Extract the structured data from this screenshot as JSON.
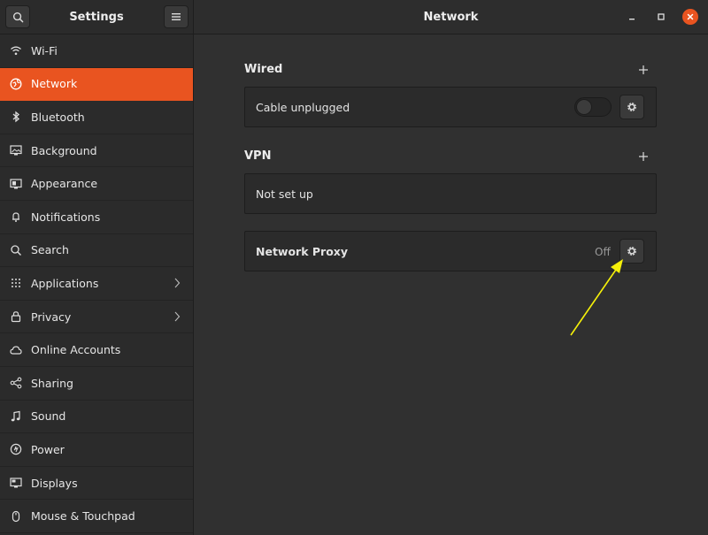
{
  "header": {
    "sidebar_title": "Settings",
    "page_title": "Network"
  },
  "sidebar": {
    "items": [
      {
        "label": "Wi-Fi",
        "icon": "wifi-icon",
        "active": false
      },
      {
        "label": "Network",
        "icon": "network-icon",
        "active": true
      },
      {
        "label": "Bluetooth",
        "icon": "bluetooth-icon",
        "active": false
      },
      {
        "label": "Background",
        "icon": "background-icon",
        "active": false
      },
      {
        "label": "Appearance",
        "icon": "appearance-icon",
        "active": false
      },
      {
        "label": "Notifications",
        "icon": "bell-icon",
        "active": false
      },
      {
        "label": "Search",
        "icon": "search-icon",
        "active": false
      },
      {
        "label": "Applications",
        "icon": "apps-grid-icon",
        "active": false,
        "chevron": true
      },
      {
        "label": "Privacy",
        "icon": "lock-icon",
        "active": false,
        "chevron": true
      },
      {
        "label": "Online Accounts",
        "icon": "cloud-icon",
        "active": false
      },
      {
        "label": "Sharing",
        "icon": "share-icon",
        "active": false
      },
      {
        "label": "Sound",
        "icon": "music-note-icon",
        "active": false
      },
      {
        "label": "Power",
        "icon": "power-icon",
        "active": false
      },
      {
        "label": "Displays",
        "icon": "display-icon",
        "active": false
      },
      {
        "label": "Mouse & Touchpad",
        "icon": "mouse-icon",
        "active": false
      }
    ]
  },
  "wired": {
    "title": "Wired",
    "connection_label": "Cable unplugged",
    "toggle_on": false
  },
  "vpn": {
    "title": "VPN",
    "status_label": "Not set up"
  },
  "proxy": {
    "label": "Network Proxy",
    "status": "Off"
  },
  "colors": {
    "accent": "#e95420",
    "annotation_arrow": "#f5f00a"
  }
}
